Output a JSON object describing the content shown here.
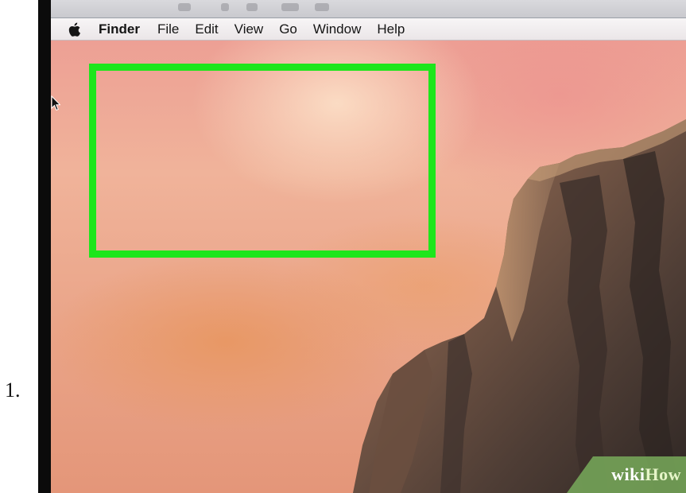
{
  "step": {
    "number": "1."
  },
  "menubar": {
    "apple_icon": "apple-logo-icon",
    "items": [
      {
        "label": "Finder"
      },
      {
        "label": "File"
      },
      {
        "label": "Edit"
      },
      {
        "label": "View"
      },
      {
        "label": "Go"
      },
      {
        "label": "Window"
      },
      {
        "label": "Help"
      }
    ]
  },
  "desktop": {
    "wallpaper": "pink sunset sky with granite cliff"
  },
  "highlight": {
    "color": "#1ee61c"
  },
  "watermark": {
    "part1": "wiki",
    "part2": "How"
  },
  "colors": {
    "menubar_bg": "#f2eef0",
    "menu_text": "#151515",
    "highlight": "#1ee61c"
  }
}
